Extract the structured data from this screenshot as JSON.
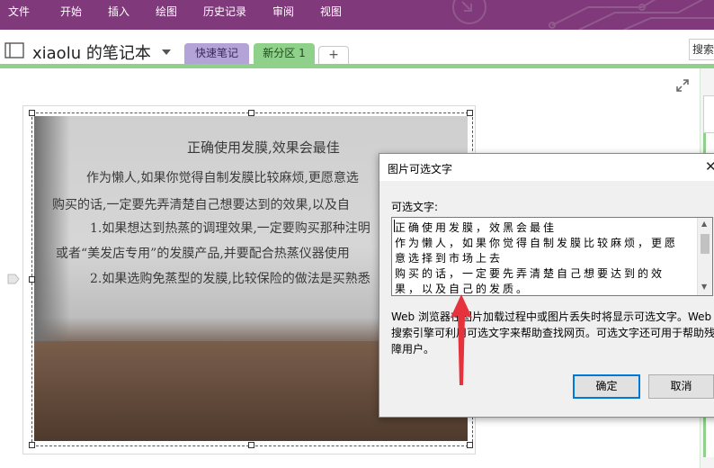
{
  "menu": [
    "文件",
    "开始",
    "插入",
    "绘图",
    "历史记录",
    "审阅",
    "视图"
  ],
  "notebook": {
    "title": "xiaolu 的笔记本"
  },
  "tabs": {
    "quick": "快速笔记",
    "section": "新分区 1",
    "add": "+"
  },
  "search": {
    "placeholder": "搜索"
  },
  "colors": {
    "ribbon": "#80397b",
    "section_tab": "#8fd08a",
    "quick_tab": "#b3a3d6",
    "accent_button": "#0078d7",
    "arrow": "#e5323c"
  },
  "photo_text": {
    "title": "正确使用发膜,效果会最佳",
    "lines": [
      "作为懒人,如果你觉得自制发膜比较麻烦,更愿意选",
      "购买的话,一定要先弄清楚自己想要达到的效果,以及自",
      "1.如果想达到热蒸的调理效果,一定要购买那种注明",
      "或者“美发店专用”的发膜产品,并要配合热蒸仪器使用",
      "2.如果选购免蒸型的发膜,比较保险的做法是买熟悉"
    ]
  },
  "dialog": {
    "title": "图片可选文字",
    "close": "✕",
    "label": "可选文字:",
    "text_lines": [
      "正确使用发膜，效黑会最佳",
      "作为懒人，如果你觉得自制发膜比较麻烦，更愿",
      "意选择到市场上去",
      "购买的话，一定要先弄清楚自己想要达到的效",
      "果，以及自己的发质。"
    ],
    "description": "Web 浏览器在图片加载过程中或图片丢失时将显示可选文字。Web 搜索引擎可利用可选文字来帮助查找网页。可选文字还可用于帮助残障用户。",
    "ok": "确定",
    "cancel": "取消"
  }
}
